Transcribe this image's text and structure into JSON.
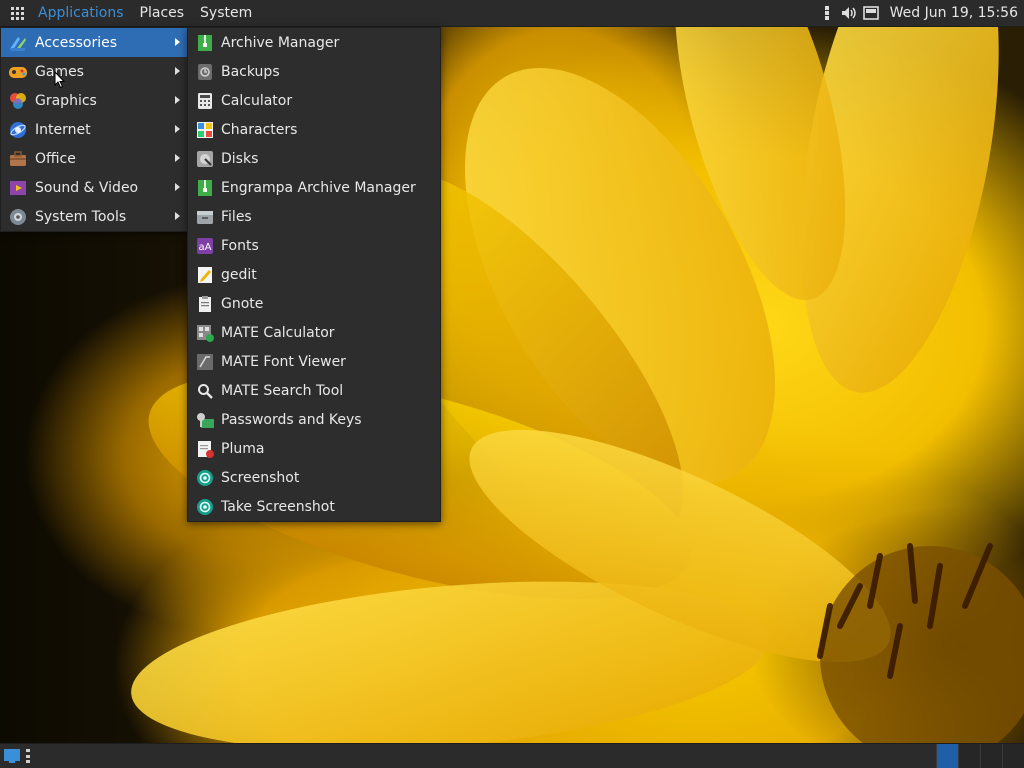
{
  "top_panel": {
    "menus": [
      "Applications",
      "Places",
      "System"
    ],
    "clock": "Wed Jun 19, 15:56"
  },
  "category_menu": {
    "items": [
      {
        "label": "Accessories",
        "icon": "accessories-icon",
        "selected": true
      },
      {
        "label": "Games",
        "icon": "games-icon"
      },
      {
        "label": "Graphics",
        "icon": "graphics-icon"
      },
      {
        "label": "Internet",
        "icon": "internet-icon"
      },
      {
        "label": "Office",
        "icon": "office-icon"
      },
      {
        "label": "Sound & Video",
        "icon": "sound-video-icon"
      },
      {
        "label": "System Tools",
        "icon": "system-tools-icon"
      }
    ]
  },
  "accessories_menu": {
    "items": [
      {
        "label": "Archive Manager",
        "icon": "archive-manager-icon"
      },
      {
        "label": "Backups",
        "icon": "backups-icon"
      },
      {
        "label": "Calculator",
        "icon": "calculator-icon"
      },
      {
        "label": "Characters",
        "icon": "characters-icon"
      },
      {
        "label": "Disks",
        "icon": "disks-icon"
      },
      {
        "label": "Engrampa Archive Manager",
        "icon": "engrampa-icon"
      },
      {
        "label": "Files",
        "icon": "files-icon"
      },
      {
        "label": "Fonts",
        "icon": "fonts-icon"
      },
      {
        "label": "gedit",
        "icon": "gedit-icon"
      },
      {
        "label": "Gnote",
        "icon": "gnote-icon"
      },
      {
        "label": "MATE Calculator",
        "icon": "mate-calculator-icon"
      },
      {
        "label": "MATE Font Viewer",
        "icon": "mate-font-viewer-icon"
      },
      {
        "label": "MATE Search Tool",
        "icon": "search-icon"
      },
      {
        "label": "Passwords and Keys",
        "icon": "passwords-keys-icon"
      },
      {
        "label": "Pluma",
        "icon": "pluma-icon"
      },
      {
        "label": "Screenshot",
        "icon": "screenshot-icon"
      },
      {
        "label": "Take Screenshot",
        "icon": "take-screenshot-icon"
      }
    ]
  },
  "colors": {
    "panel_bg": "#2b2b2b",
    "menu_bg": "#2d2d2d",
    "selection": "#2e6db4",
    "active_menu_text": "#3b8fd8"
  }
}
